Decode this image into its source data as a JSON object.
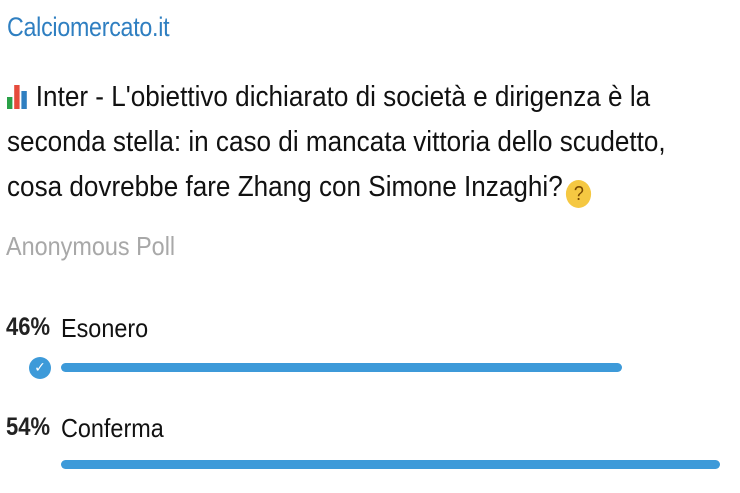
{
  "channel": {
    "name": "Calciomercato.it"
  },
  "poll": {
    "question_icon": "bar-chart-icon",
    "question": "Inter - L'obiettivo dichiarato di società e dirigenza è la seconda stella: in caso di mancata vittoria dello scudetto, cosa dovrebbe fare Zhang con Simone Inzaghi?",
    "question_emoji": "thinking-face-icon",
    "type_label": "Anonymous Poll",
    "options": [
      {
        "percent": "46%",
        "label": "Esonero",
        "fraction": 0.46,
        "voted": true
      },
      {
        "percent": "54%",
        "label": "Conferma",
        "fraction": 0.54,
        "voted": false
      }
    ]
  },
  "colors": {
    "channel": "#2f7fc1",
    "bar": "#3d9ad9",
    "muted": "#a8a8a8"
  }
}
